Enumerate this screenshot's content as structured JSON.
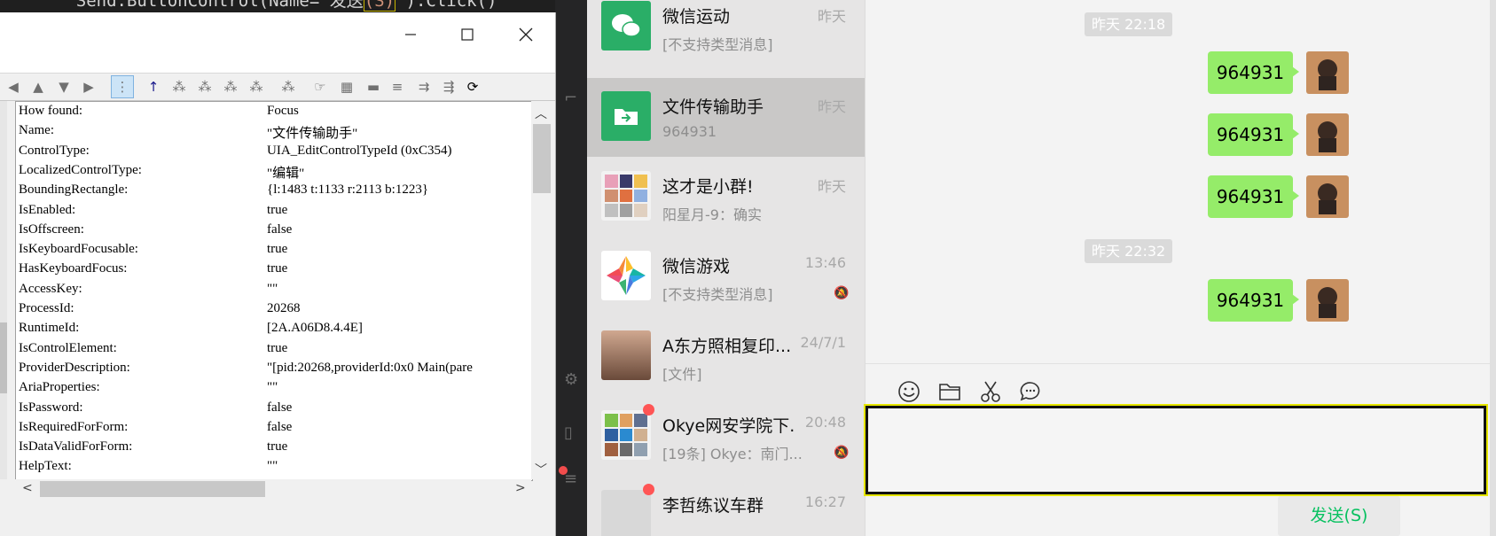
{
  "editor": {
    "code_before": "    Send.ButtonControl(Name=\"发送",
    "code_highlight": "(S)",
    "code_after": "\").Click()"
  },
  "inspector": {
    "properties": [
      {
        "key": "How found:",
        "value": "Focus"
      },
      {
        "key": "Name:",
        "value": "\"文件传输助手\""
      },
      {
        "key": "ControlType:",
        "value": "UIA_EditControlTypeId (0xC354)"
      },
      {
        "key": "LocalizedControlType:",
        "value": "\"编辑\""
      },
      {
        "key": "BoundingRectangle:",
        "value": "{l:1483 t:1133 r:2113 b:1223}"
      },
      {
        "key": "IsEnabled:",
        "value": "true"
      },
      {
        "key": "IsOffscreen:",
        "value": "false"
      },
      {
        "key": "IsKeyboardFocusable:",
        "value": "true"
      },
      {
        "key": "HasKeyboardFocus:",
        "value": "true"
      },
      {
        "key": "AccessKey:",
        "value": "\"\""
      },
      {
        "key": "ProcessId:",
        "value": "20268"
      },
      {
        "key": "RuntimeId:",
        "value": "[2A.A06D8.4.4E]"
      },
      {
        "key": "IsControlElement:",
        "value": "true"
      },
      {
        "key": "ProviderDescription:",
        "value": "\"[pid:20268,providerId:0x0 Main(pare"
      },
      {
        "key": "AriaProperties:",
        "value": "\"\""
      },
      {
        "key": "IsPassword:",
        "value": "false"
      },
      {
        "key": "IsRequiredForForm:",
        "value": "false"
      },
      {
        "key": "IsDataValidForForm:",
        "value": "true"
      },
      {
        "key": "HelpText:",
        "value": "\"\""
      }
    ]
  },
  "chatlist": {
    "items": [
      {
        "name": "微信运动",
        "preview": "[不支持类型消息]",
        "time": "昨天"
      },
      {
        "name": "文件传输助手",
        "preview": "964931",
        "time": "昨天"
      },
      {
        "name": "这才是小群!",
        "preview": "阳星月-9：确实",
        "time": "昨天"
      },
      {
        "name": "微信游戏",
        "preview": "[不支持类型消息]",
        "time": "13:46"
      },
      {
        "name": "A东方照相复印...",
        "preview": "[文件]",
        "time": "24/7/1"
      },
      {
        "name": "Okye网安学院下...",
        "preview": "[19条] Okye：南门...",
        "time": "20:48"
      },
      {
        "name": "李哲练议车群",
        "preview": "",
        "time": "16:27"
      }
    ]
  },
  "conversation": {
    "timestamps": [
      "昨天 22:18",
      "昨天 22:32"
    ],
    "messages": [
      "964931",
      "964931",
      "964931",
      "964931"
    ],
    "send_label": "发送(S)"
  },
  "colors": {
    "bubble": "#95ec69",
    "send_text": "#07c160",
    "wechat_green": "#2aae67"
  }
}
